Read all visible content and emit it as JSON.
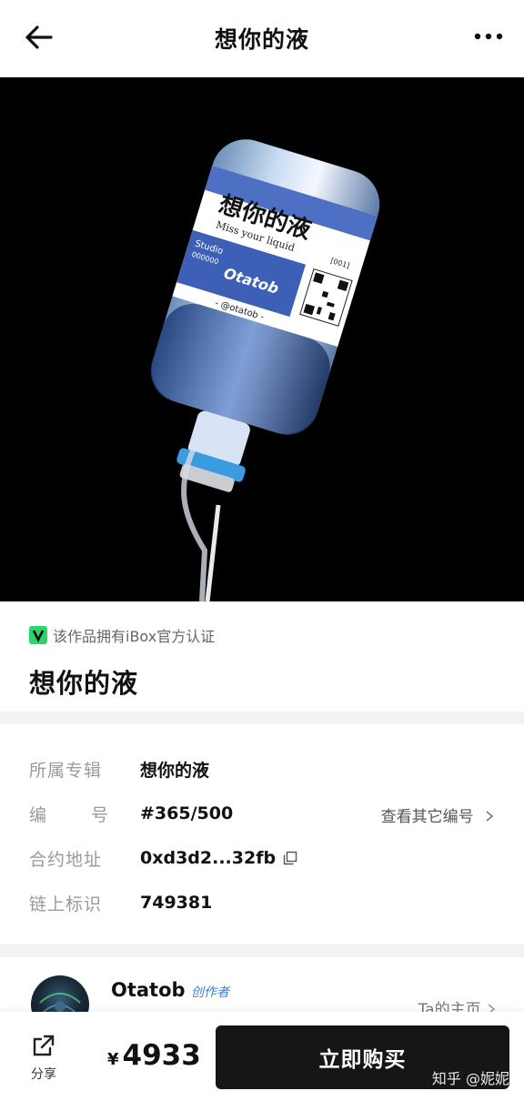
{
  "header": {
    "title": "想你的液",
    "back_icon": "arrow-left-icon",
    "more_icon": "more-horizontal-icon"
  },
  "hero": {
    "label_title": "想你的液",
    "label_subtitle": "Miss your liquid",
    "label_tag": "[001]",
    "label_studio": "Studio",
    "label_serial": "000000",
    "label_logo": "Otatob",
    "label_handle": "- @otatob -"
  },
  "certification": {
    "text": "该作品拥有iBox官方认证",
    "badge_color": "#2fd36b"
  },
  "artwork": {
    "title": "想你的液"
  },
  "details": {
    "album_label": "所属专辑",
    "album_value": "想你的液",
    "number_label_a": "编",
    "number_label_b": "号",
    "number_value": "#365/500",
    "other_numbers_link": "查看其它编号",
    "contract_label": "合约地址",
    "contract_value": "0xd3d2...32fb",
    "chain_label": "链上标识",
    "chain_value": "749381"
  },
  "creator": {
    "name": "Otatob",
    "tag": "创作者",
    "home_link": "Ta的主页"
  },
  "bottom_bar": {
    "share_label": "分享",
    "price_symbol": "¥",
    "price_value": "4933",
    "buy_label": "立即购买",
    "button_color": "#161616"
  },
  "watermark": "知乎 @妮妮"
}
